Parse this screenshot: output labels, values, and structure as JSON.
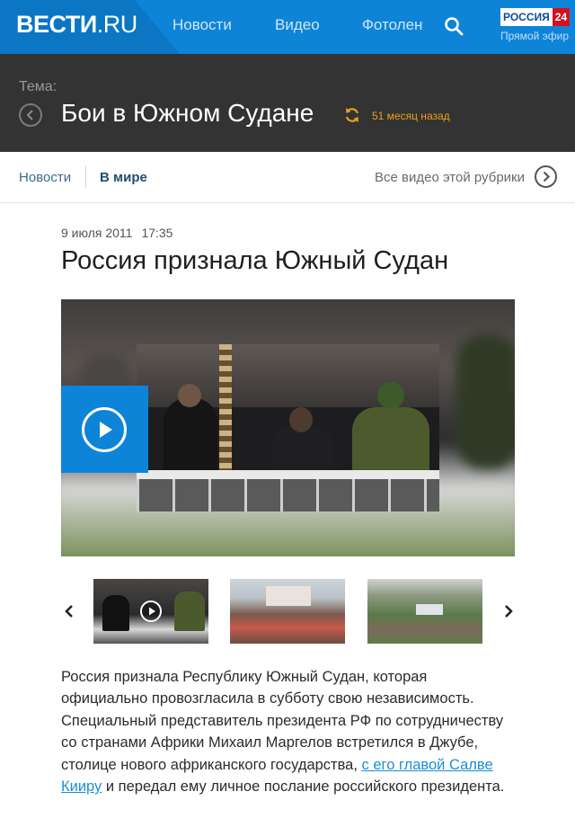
{
  "header": {
    "logo_main": "ВЕСТИ",
    "logo_suffix": ".RU",
    "nav": [
      "Новости",
      "Видео",
      "Фотолент"
    ],
    "channel_name": "РОССИЯ",
    "channel_num": "24",
    "live_label": "Прямой эфир",
    "colors": {
      "bar": "#0e84d8",
      "channel_red": "#d4101f"
    }
  },
  "topic": {
    "label": "Тема:",
    "title": "Бои в Южном Судане",
    "ago": "51 месяц назад",
    "accent": "#e9a021"
  },
  "subnav": {
    "news": "Новости",
    "world": "В мире",
    "all_videos": "Все видео этой рубрики"
  },
  "article": {
    "date": "9 июля 2011",
    "time": "17:35",
    "headline": "Россия признала Южный Судан",
    "body_before": "Россия признала Республику Южный Судан, которая официально провозгласила в субботу свою независимость. Специальный представитель президента РФ по сотрудничеству со странами Африки Михаил Маргелов встретился в Джубе, столице нового африканского государства, ",
    "link_text": "с его главой Салве Кииру",
    "body_after": " и передал ему личное послание российского президента."
  },
  "video": {
    "icons": [
      "play-icon"
    ]
  },
  "thumbnails": {
    "icons": [
      "chevron-left-icon",
      "chevron-right-icon"
    ],
    "count": 3
  }
}
